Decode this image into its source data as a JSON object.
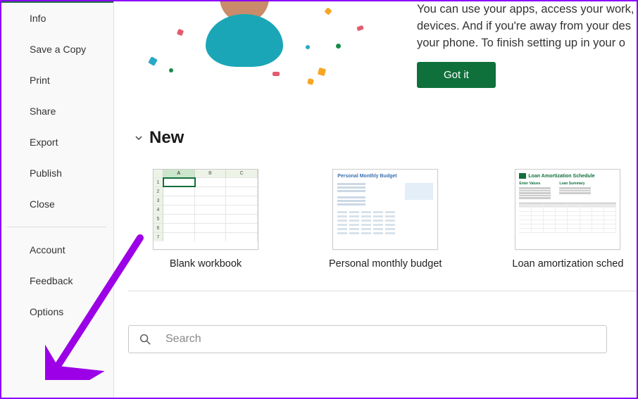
{
  "sidebar": {
    "items_top": [
      {
        "label": "Info"
      },
      {
        "label": "Save a Copy"
      },
      {
        "label": "Print"
      },
      {
        "label": "Share"
      },
      {
        "label": "Export"
      },
      {
        "label": "Publish"
      },
      {
        "label": "Close"
      }
    ],
    "items_bottom": [
      {
        "label": "Account"
      },
      {
        "label": "Feedback"
      },
      {
        "label": "Options"
      }
    ]
  },
  "promo": {
    "text": "You can use your apps, access your work, devices. And if you're away from your des your phone. To finish setting up in your o",
    "button": "Got it"
  },
  "new_section": {
    "title": "New",
    "templates": [
      {
        "label": "Blank workbook"
      },
      {
        "label": "Personal monthly budget"
      },
      {
        "label": "Loan amortization sched"
      }
    ],
    "blank_thumb": {
      "cols": [
        "",
        "A",
        "B",
        "C"
      ],
      "rows": [
        "1",
        "2",
        "3",
        "4",
        "5",
        "6",
        "7"
      ]
    },
    "budget_thumb_title": "Personal Monthly Budget",
    "loan_thumb_title": "Loan Amortization Schedule",
    "loan_col1": "Enter Values",
    "loan_col2": "Loan Summary"
  },
  "search": {
    "placeholder": "Search"
  },
  "colors": {
    "accent": "#0f703b",
    "annotation": "#9b00e6"
  }
}
